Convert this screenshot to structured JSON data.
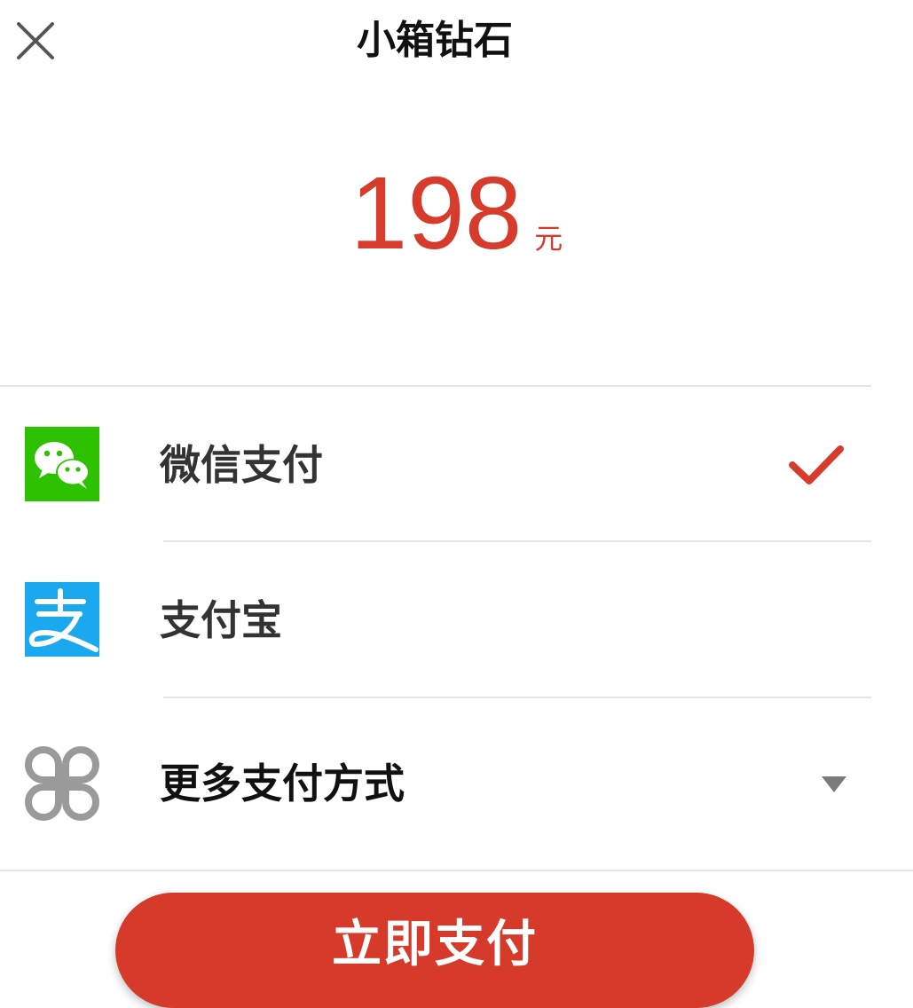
{
  "header": {
    "title": "小箱钻石",
    "close_icon": "close-icon"
  },
  "price": {
    "amount": "198",
    "unit": "元",
    "color": "#d63b2b"
  },
  "payment_methods": [
    {
      "label": "微信支付",
      "icon": "wechat-pay-icon",
      "icon_color": "#2dc100",
      "selected": true
    },
    {
      "label": "支付宝",
      "icon": "alipay-icon",
      "icon_color": "#1aa8ee",
      "selected": false
    },
    {
      "label": "更多支付方式",
      "icon": "more-payment-icon",
      "icon_color": "#9a9a9a",
      "expandable": true
    }
  ],
  "selected_indicator": {
    "icon": "check-icon",
    "color": "#d63b2b"
  },
  "more_indicator": {
    "icon": "dropdown-triangle-icon"
  },
  "pay_button": {
    "label": "立即支付",
    "color": "#d63a2a"
  }
}
